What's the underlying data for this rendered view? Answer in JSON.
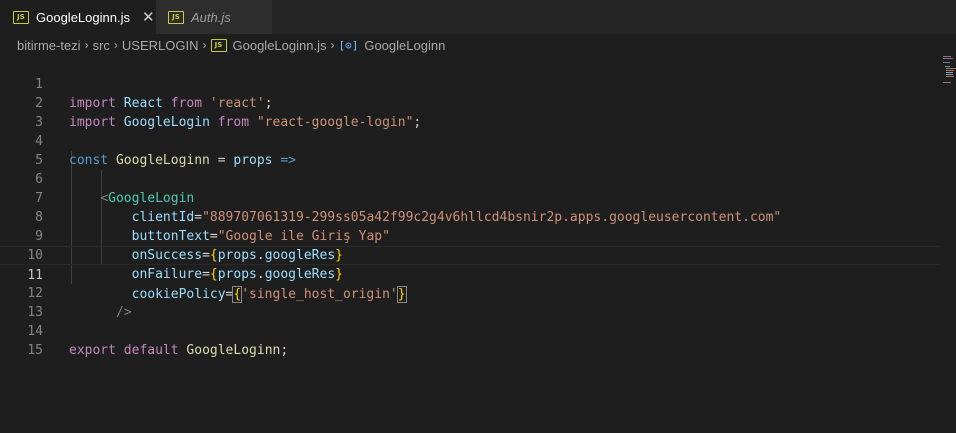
{
  "tabs": [
    {
      "label": "GoogleLoginn.js",
      "badge": "JS",
      "close": "✕"
    },
    {
      "label": "Auth.js",
      "badge": "JS"
    }
  ],
  "breadcrumb": {
    "items": [
      "bitirme-tezi",
      "src",
      "USERLOGIN",
      "GoogleLoginn.js",
      "GoogleLoginn"
    ],
    "separator": "›",
    "file_badge": "JS",
    "symbol_icon": "[⊙]"
  },
  "editor": {
    "line_numbers": [
      "1",
      "2",
      "3",
      "4",
      "5",
      "6",
      "7",
      "8",
      "9",
      "10",
      "11",
      "12",
      "13",
      "14",
      "15"
    ],
    "code": {
      "l1": {
        "import": "import",
        "name": "React",
        "from": "from",
        "module": "'react'",
        "semi": ";"
      },
      "l2": {
        "import": "import",
        "name": "GoogleLogin",
        "from": "from",
        "module": "\"react-google-login\"",
        "semi": ";"
      },
      "l4": {
        "const": "const",
        "name": "GoogleLoginn",
        "eq": "=",
        "param": "props",
        "arrow": "=>"
      },
      "l6": {
        "open": "<",
        "tag": "GoogleLogin"
      },
      "l7": {
        "attr": "clientId",
        "eq": "=",
        "value": "\"889707061319-299ss05a42f99c2g4v6hllcd4bsnir2p.apps.googleusercontent.com\""
      },
      "l8": {
        "attr": "buttonText",
        "eq": "=",
        "value": "\"Google ile Giriş Yap\""
      },
      "l9": {
        "attr": "onSuccess",
        "eq": "=",
        "lb": "{",
        "obj": "props",
        "dot": ".",
        "prop": "googleRes",
        "rb": "}"
      },
      "l10": {
        "attr": "onFailure",
        "eq": "=",
        "lb": "{",
        "obj": "props",
        "dot": ".",
        "prop": "googleRes",
        "rb": "}"
      },
      "l11": {
        "attr": "cookiePolicy",
        "eq": "=",
        "lb": "{",
        "value": "'single_host_origin'",
        "rb": "}"
      },
      "l12": {
        "close": "/>"
      },
      "l14": {
        "export": "export",
        "default": "default",
        "name": "GoogleLoginn",
        "semi": ";"
      }
    }
  },
  "colors": {
    "keyword": "#c586c0",
    "storage": "#569cd6",
    "variable": "#9cdcfe",
    "function": "#dcdcaa",
    "string": "#ce9178",
    "tag": "#4ec9b0",
    "bracket": "#ffd700"
  }
}
